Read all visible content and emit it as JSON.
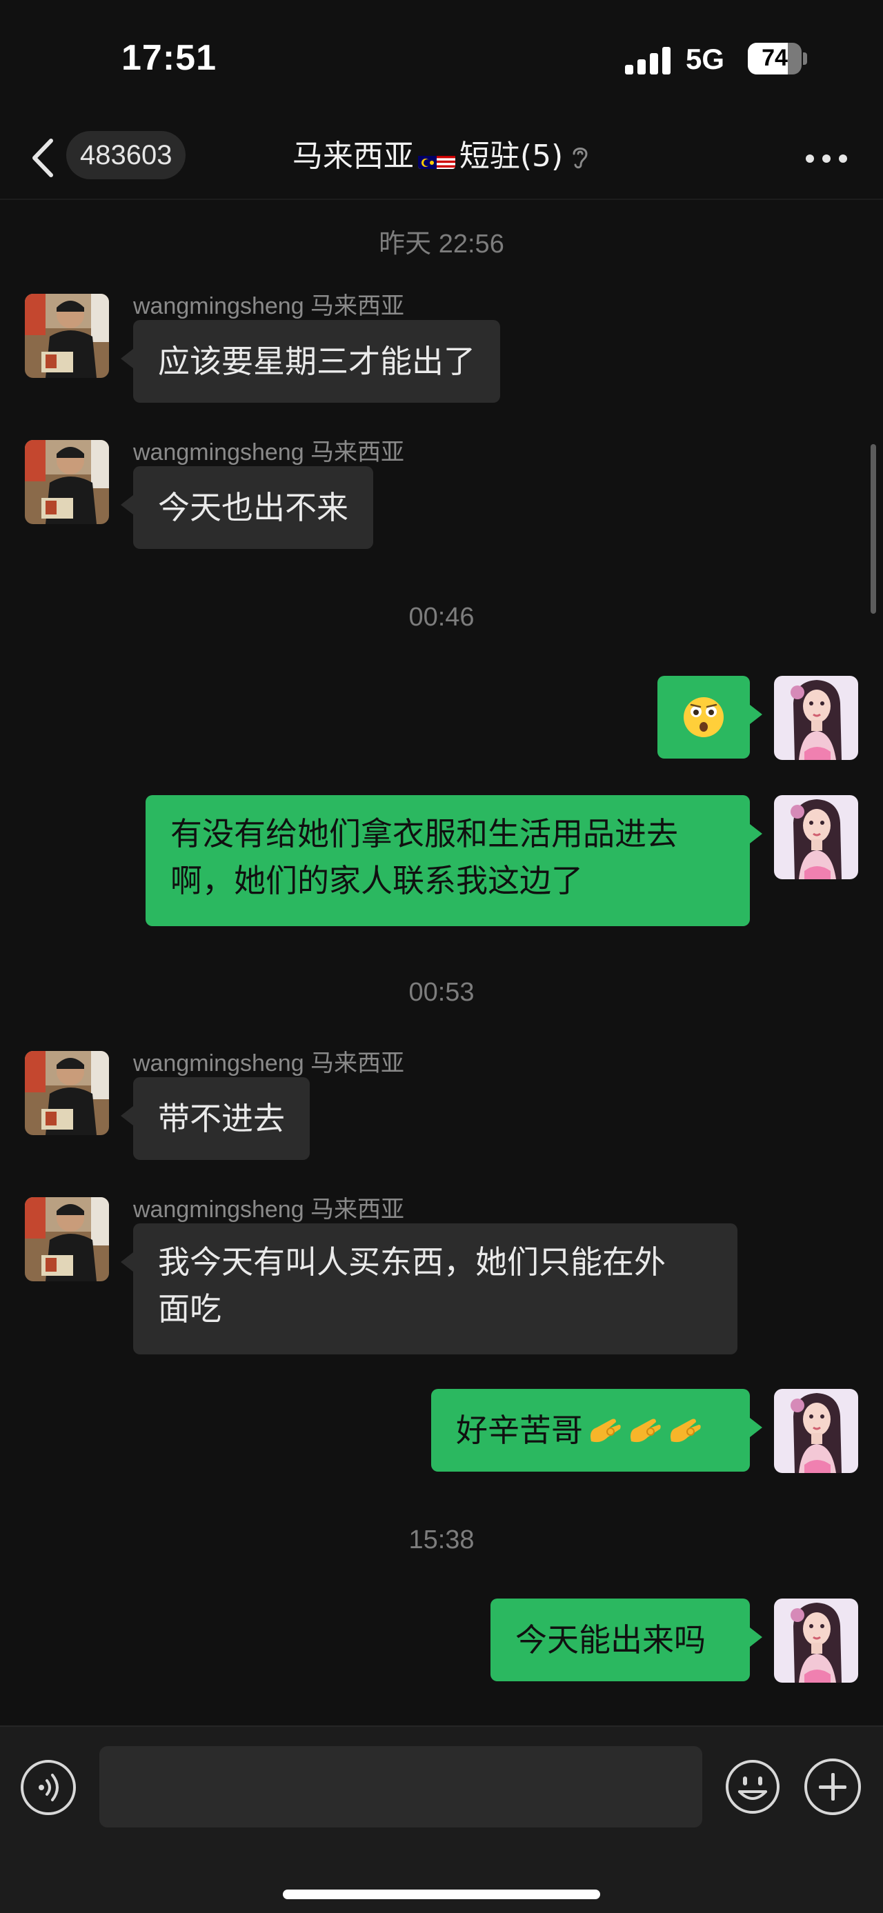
{
  "status_bar": {
    "time": "17:51",
    "network": "5G",
    "battery": "74",
    "battery_level": 0.74
  },
  "header": {
    "back_icon": "chevron-left-icon",
    "unread_count": "483603",
    "title_prefix": "马来西亚",
    "title_flag": "malaysia-flag-icon",
    "title_suffix": "短驻(5)",
    "mute_icon": "ear-icon",
    "more_icon": "more-dots-icon"
  },
  "messages": [
    {
      "type": "timestamp",
      "text": "昨天 22:56"
    },
    {
      "type": "in",
      "sender": "wangmingsheng 马来西亚",
      "text": "应该要星期三才能出了"
    },
    {
      "type": "in",
      "sender": "wangmingsheng 马来西亚",
      "text": "今天也出不来"
    },
    {
      "type": "timestamp",
      "text": "00:46"
    },
    {
      "type": "out",
      "emoji": "astonished-face-emoji"
    },
    {
      "type": "out",
      "lines": [
        "有没有给她们拿衣服和生活用品进去",
        "啊，她们的家人联系我这边了"
      ]
    },
    {
      "type": "timestamp",
      "text": "00:53"
    },
    {
      "type": "in",
      "sender": "wangmingsheng 马来西亚",
      "text": "带不进去"
    },
    {
      "type": "in",
      "sender": "wangmingsheng 马来西亚",
      "lines": [
        "我今天有叫人买东西，她们只能在外",
        "面吃"
      ]
    },
    {
      "type": "out",
      "text": "好辛苦哥",
      "emoji": "ok-hand-emoji",
      "emoji_count": 3
    },
    {
      "type": "timestamp",
      "text": "15:38"
    },
    {
      "type": "out",
      "text": "今天能出来吗"
    }
  ],
  "input_bar": {
    "voice_icon": "voice-icon",
    "emoji_icon": "emoji-icon",
    "plus_icon": "plus-icon"
  },
  "colors": {
    "background": "#111111",
    "incoming_bubble": "#2c2c2c",
    "outgoing_bubble": "#2bb860",
    "timestamp": "#7d7d7d"
  }
}
